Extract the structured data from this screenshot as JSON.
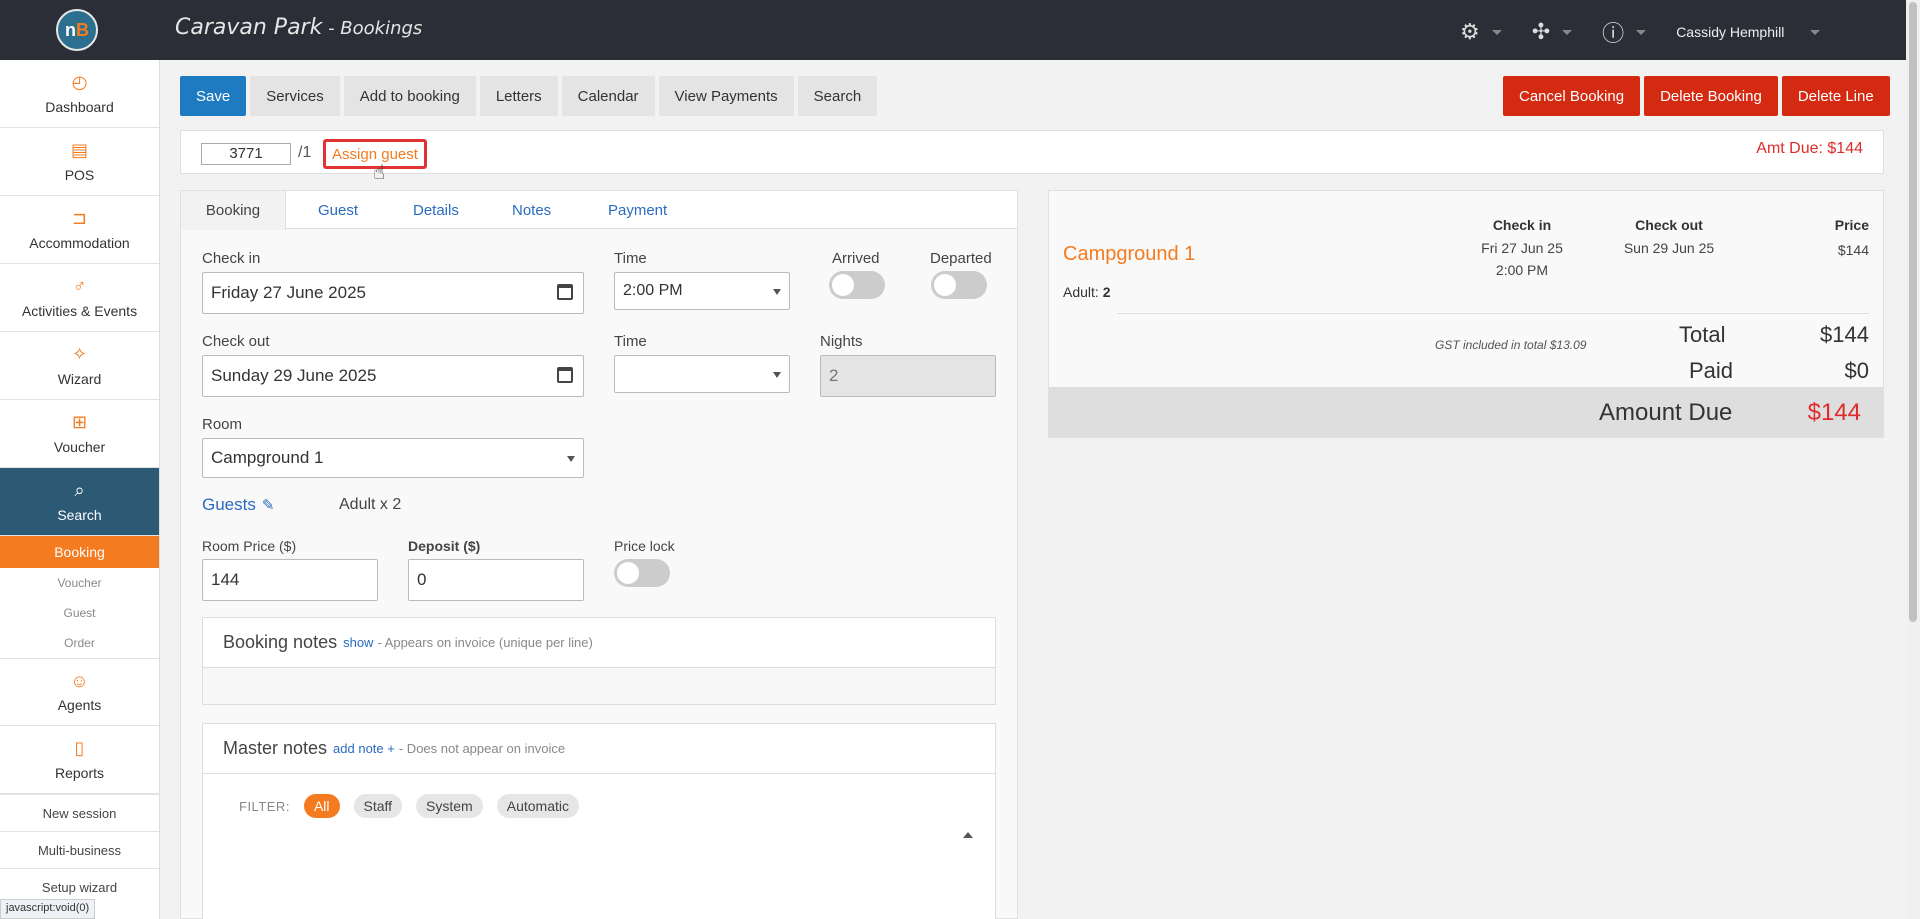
{
  "header": {
    "logo_text": "nB",
    "title": "Caravan Park",
    "subtitle": " - Bookings",
    "icons": [
      "gears-icon",
      "puzzle-icon",
      "help-icon"
    ],
    "user": "Cassidy Hemphill"
  },
  "sidebar": {
    "items": [
      {
        "label": "Dashboard",
        "icon": "dashboard-icon"
      },
      {
        "label": "POS",
        "icon": "register-icon"
      },
      {
        "label": "Accommodation",
        "icon": "bed-icon"
      },
      {
        "label": "Activities & Events",
        "icon": "activities-icon"
      },
      {
        "label": "Wizard",
        "icon": "wand-icon"
      },
      {
        "label": "Voucher",
        "icon": "gift-icon"
      },
      {
        "label": "Search",
        "icon": "search-icon"
      }
    ],
    "sub": [
      "Booking",
      "Voucher",
      "Guest",
      "Order"
    ],
    "items2": [
      {
        "label": "Agents",
        "icon": "agents-icon"
      },
      {
        "label": "Reports",
        "icon": "report-icon"
      }
    ],
    "links": [
      "New session",
      "Multi-business",
      "Setup wizard"
    ]
  },
  "toolbar": {
    "left": [
      "Save",
      "Services",
      "Add to booking",
      "Letters",
      "Calendar",
      "View Payments",
      "Search"
    ],
    "right": [
      "Cancel Booking",
      "Delete Booking",
      "Delete Line"
    ]
  },
  "booking_id": {
    "number": "3771",
    "suffix": "/1",
    "assign": "Assign guest",
    "amt_due": "Amt Due: $144"
  },
  "tabs": [
    "Booking",
    "Guest",
    "Details",
    "Notes",
    "Payment"
  ],
  "form": {
    "checkin_label": "Check in",
    "checkin_value": "Friday 27 June 2025",
    "time_label": "Time",
    "checkin_time": "2:00 PM",
    "arrived_label": "Arrived",
    "departed_label": "Departed",
    "checkout_label": "Check out",
    "checkout_value": "Sunday 29 June 2025",
    "checkout_time": "",
    "nights_label": "Nights",
    "nights_value": "2",
    "room_label": "Room",
    "room_value": "Campground 1",
    "guests_label": "Guests",
    "guests_value": "Adult x 2",
    "price_label": "Room Price ($)",
    "price_value": "144",
    "deposit_label": "Deposit ($)",
    "deposit_value": "0",
    "pricelock_label": "Price lock"
  },
  "booking_notes": {
    "title": "Booking notes",
    "link": "show",
    "desc": "- Appears on invoice (unique per line)"
  },
  "master_notes": {
    "title": "Master notes",
    "link": "add note +",
    "desc": "- Does not appear on invoice",
    "filter_label": "FILTER:",
    "filters": [
      "All",
      "Staff",
      "System",
      "Automatic"
    ]
  },
  "summary": {
    "room": "Campground 1",
    "adult_label": "Adult:",
    "adult_count": "2",
    "checkin_h": "Check in",
    "checkin_date": "Fri 27 Jun 25",
    "checkin_time": "2:00 PM",
    "checkout_h": "Check out",
    "checkout_date": "Sun 29 Jun 25",
    "price_h": "Price",
    "price": "$144",
    "gst": "GST included in total $13.09",
    "total_label": "Total",
    "total": "$144",
    "paid_label": "Paid",
    "paid": "$0",
    "amount_due_label": "Amount Due",
    "amount_due": "$144"
  },
  "status_bar": "javascript:void(0)"
}
